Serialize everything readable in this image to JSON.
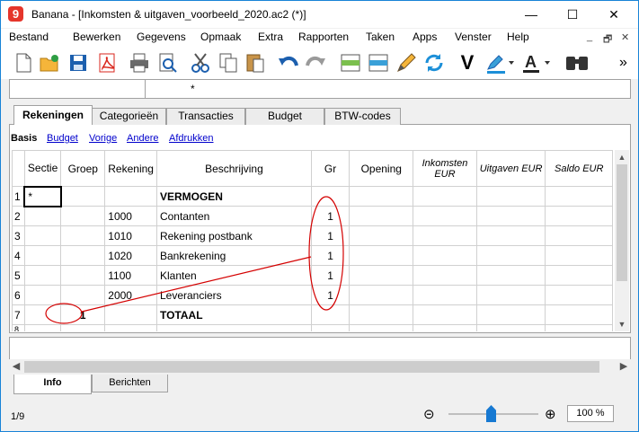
{
  "window": {
    "title": "Banana - [Inkomsten & uitgaven_voorbeeld_2020.ac2 (*)]",
    "app_icon_glyph": "9",
    "minimize": "—",
    "maximize": "☐",
    "close": "✕"
  },
  "menu": [
    "Bestand",
    "Bewerken",
    "Gegevens",
    "Opmaak",
    "Extra",
    "Rapporten",
    "Taken",
    "Apps",
    "Venster",
    "Help"
  ],
  "menu_mdi": {
    "min": "_",
    "restore": "🗗",
    "close": "✕"
  },
  "toolbar": {
    "icons": [
      "new-file-icon",
      "open-folder-icon",
      "save-icon",
      "pdf-icon",
      "print-icon",
      "print-preview-icon",
      "cut-icon",
      "copy-icon",
      "paste-icon",
      "undo-icon",
      "redo-icon",
      "add-row-icon",
      "insert-row-icon",
      "edit-pencil-icon",
      "recheck-icon",
      "validate-icon",
      "highlighter-icon",
      "font-color-icon",
      "find-icon",
      "more-icon"
    ],
    "validate_glyph": "V",
    "more_glyph": "»"
  },
  "cellbar": {
    "value": "*"
  },
  "tabs": [
    "Rekeningen",
    "Categorieën",
    "Transacties",
    "Budget",
    "BTW-codes"
  ],
  "views": {
    "current": "Basis",
    "links": [
      "Budget",
      "Vorige",
      "Andere",
      "Afdrukken"
    ]
  },
  "table": {
    "headers": [
      "Sectie",
      "Groep",
      "Rekening",
      "Beschrijving",
      "Gr",
      "Opening",
      "Inkomsten EUR",
      "Uitgaven EUR",
      "Saldo EUR"
    ],
    "rows": [
      {
        "n": "1",
        "sectie": "*",
        "groep": "",
        "rekening": "",
        "beschrijving": "VERMOGEN",
        "gr": "",
        "bold": true
      },
      {
        "n": "2",
        "sectie": "",
        "groep": "",
        "rekening": "1000",
        "beschrijving": "Contanten",
        "gr": "1",
        "bold": false
      },
      {
        "n": "3",
        "sectie": "",
        "groep": "",
        "rekening": "1010",
        "beschrijving": "Rekening postbank",
        "gr": "1",
        "bold": false
      },
      {
        "n": "4",
        "sectie": "",
        "groep": "",
        "rekening": "1020",
        "beschrijving": "Bankrekening",
        "gr": "1",
        "bold": false
      },
      {
        "n": "5",
        "sectie": "",
        "groep": "",
        "rekening": "1100",
        "beschrijving": "Klanten",
        "gr": "1",
        "bold": false
      },
      {
        "n": "6",
        "sectie": "",
        "groep": "",
        "rekening": "2000",
        "beschrijving": "Leveranciers",
        "gr": "1",
        "bold": false
      },
      {
        "n": "7",
        "sectie": "",
        "groep": "1",
        "rekening": "",
        "beschrijving": "TOTAAL",
        "gr": "",
        "bold": true
      }
    ],
    "partial_row_number": "8"
  },
  "bottom_tabs": [
    "Info",
    "Berichten"
  ],
  "status": {
    "count": "1/9",
    "zoom": "100 %",
    "zoom_level_percent": 100
  },
  "annotation_color": "#d40000"
}
